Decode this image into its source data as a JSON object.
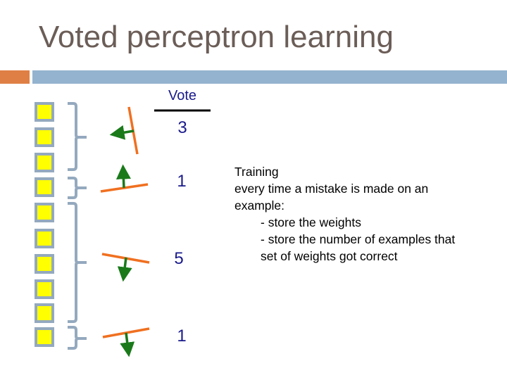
{
  "slide": {
    "title": "Voted perceptron learning",
    "accent_colors": {
      "orange": "#df7f45",
      "blue": "#94b3cf",
      "title": "#6b5d57"
    }
  },
  "diagram": {
    "vote_header": "Vote",
    "examples_count": 10,
    "groups": [
      {
        "examples": 3,
        "vote": "3",
        "normal_direction": "left"
      },
      {
        "examples": 1,
        "vote": "1",
        "normal_direction": "up"
      },
      {
        "examples": 5,
        "vote": "5",
        "normal_direction": "down"
      },
      {
        "examples": 1,
        "vote": "1",
        "normal_direction": "down"
      }
    ],
    "colors": {
      "example_fill": "#ffff00",
      "example_border": "#94a9be",
      "bracket": "#94a9be",
      "hyperplane": "#f07020",
      "normal_arrow": "#1a7a1a",
      "vote_text": "#1a1a8c"
    }
  },
  "training": {
    "heading": "Training",
    "line1": "every time a mistake is made on an",
    "line2": "example:",
    "bullet1": "- store the weights",
    "bullet2a": "- store the number of examples that",
    "bullet2b": "set of weights got correct"
  }
}
